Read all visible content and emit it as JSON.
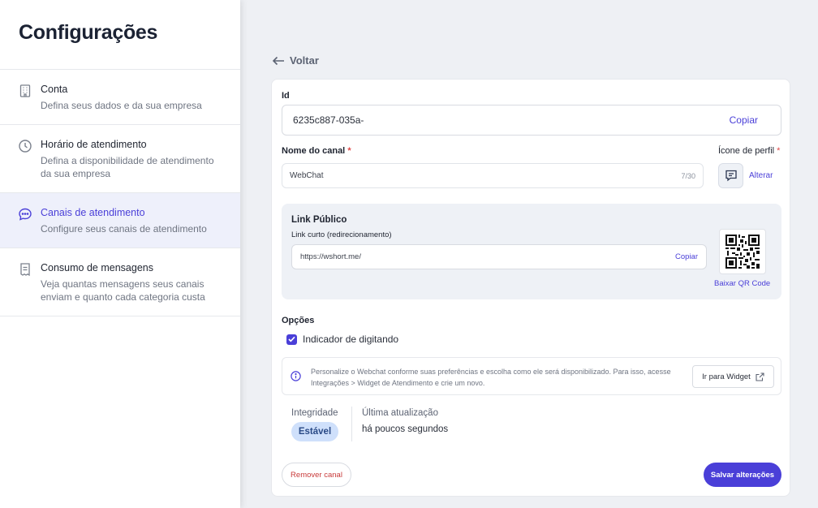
{
  "sidebar": {
    "title": "Configurações",
    "items": [
      {
        "title": "Conta",
        "desc": "Defina seus dados e da sua empresa",
        "icon": "building-icon"
      },
      {
        "title": "Horário de atendimento",
        "desc": "Defina a disponibilidade de atendimento da sua empresa",
        "icon": "clock-icon"
      },
      {
        "title": "Canais de atendimento",
        "desc": "Configure seus canais de atendimento",
        "icon": "chat-bubble-icon"
      },
      {
        "title": "Consumo de mensagens",
        "desc": "Veja quantas mensagens seus canais enviam e quanto cada categoria custa",
        "icon": "receipt-icon"
      }
    ]
  },
  "nav": {
    "back_label": "Voltar"
  },
  "form": {
    "id_label": "Id",
    "id_value": "6235c887-035a-",
    "copy_label": "Copiar",
    "name_label": "Nome do canal",
    "name_value": "WebChat",
    "name_counter": "7/30",
    "required_mark": "*",
    "profile_icon_label": "Ícone de perfil",
    "change_label": "Alterar",
    "public_link": {
      "title": "Link Público",
      "short_label": "Link curto (redirecionamento)",
      "short_value": "https://wshort.me/",
      "copy_label": "Copiar",
      "qr_download": "Baixar QR Code"
    },
    "options_label": "Opções",
    "typing_indicator_label": "Indicador de digitando",
    "typing_indicator_checked": true,
    "info_text": "Personalize o Webchat conforme suas preferências e escolha como ele será disponibilizado. Para isso, acesse Integrações > Widget de Atendimento e crie um novo.",
    "widget_button": "Ir para Widget",
    "integrity_label": "Integridade",
    "integrity_status": "Estável",
    "last_update_label": "Última atualização",
    "last_update_value": "há poucos segundos",
    "remove_button": "Remover canal",
    "save_button": "Salvar alterações"
  },
  "colors": {
    "accent": "#4a3fd8",
    "danger": "#c83a3a",
    "badge_bg": "#cfe0fb",
    "active_item_bg": "#eef0fb"
  }
}
